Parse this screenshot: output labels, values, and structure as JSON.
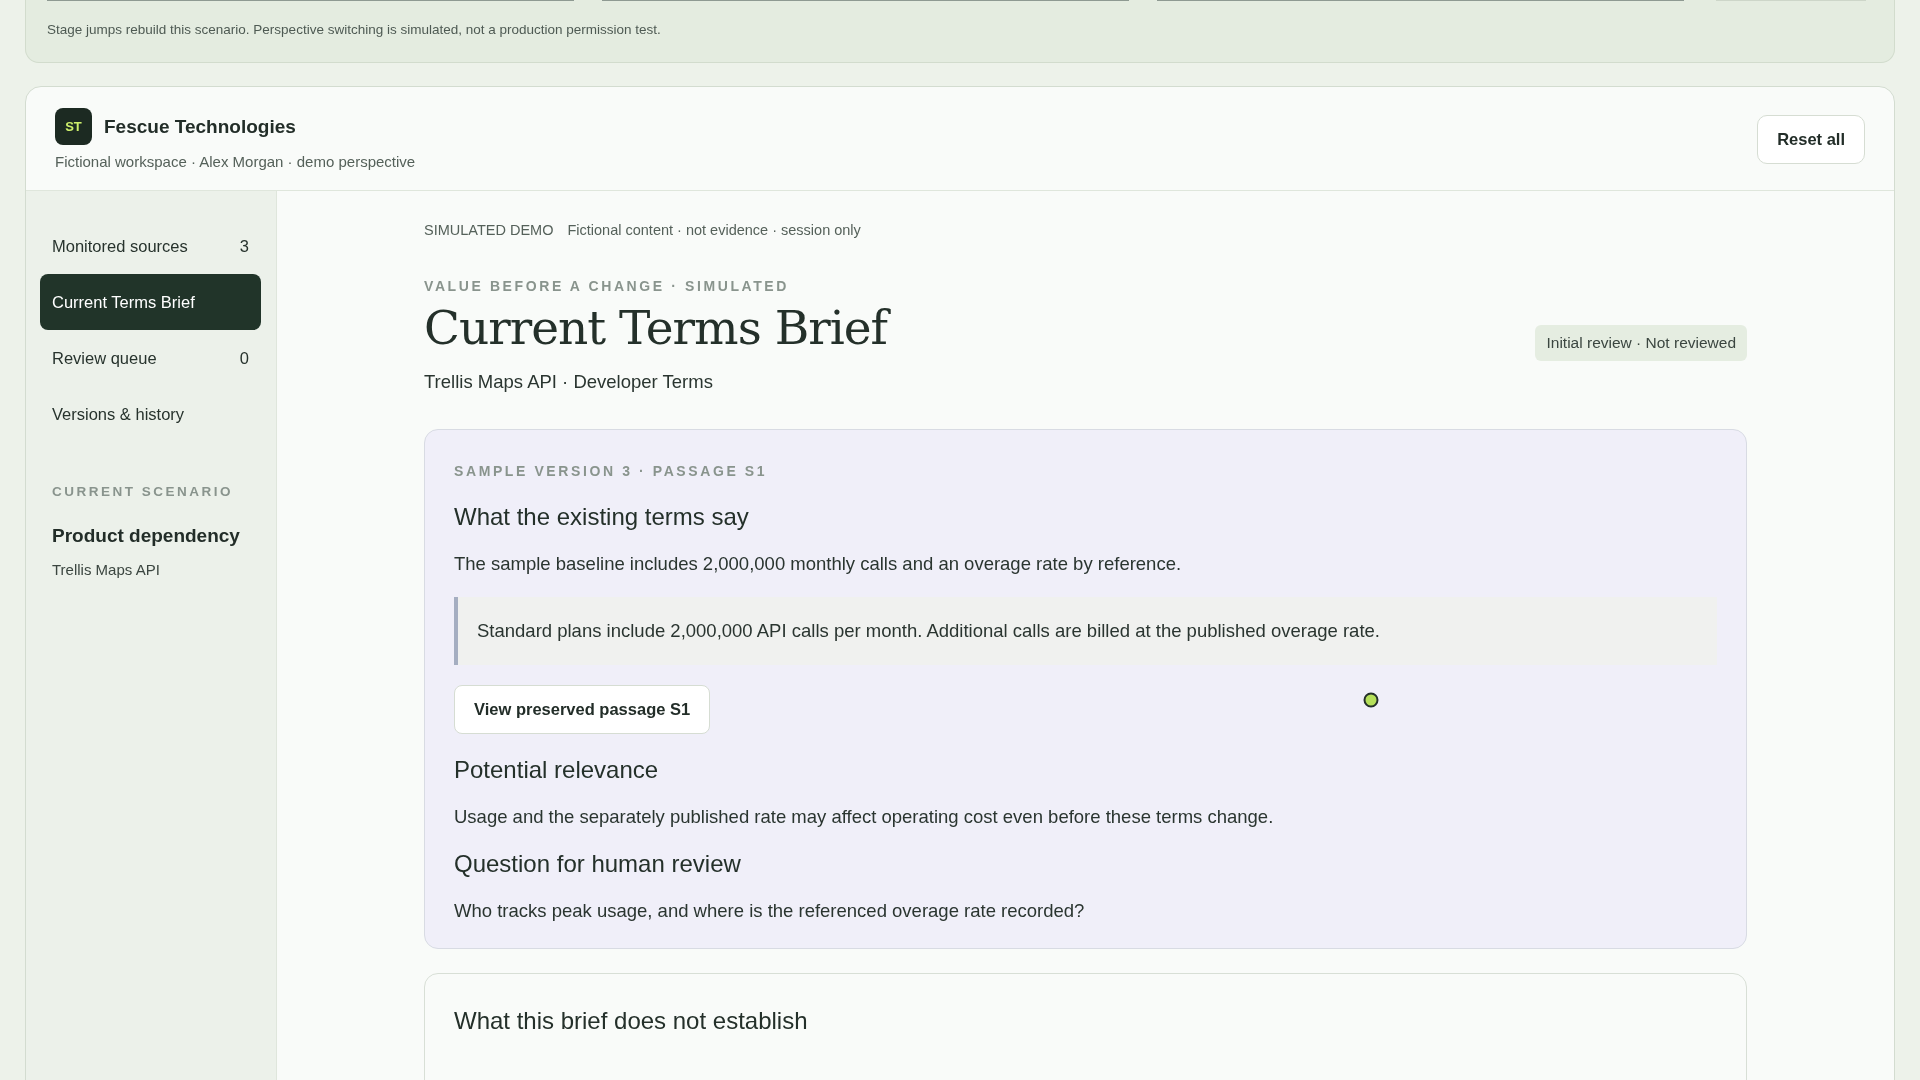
{
  "notice": "Stage jumps rebuild this scenario. Perspective switching is simulated, not a production permission test.",
  "workspace": {
    "initials": "ST",
    "name": "Fescue Technologies",
    "subtitle": "Fictional workspace · Alex Morgan · demo perspective",
    "reset_button": "Reset all"
  },
  "sidebar": {
    "items": [
      {
        "label": "Monitored sources",
        "count": "3",
        "selected": false
      },
      {
        "label": "Current Terms Brief",
        "selected": true
      },
      {
        "label": "Review queue",
        "count": "0",
        "selected": false
      },
      {
        "label": "Versions & history",
        "selected": false
      }
    ],
    "scenario_heading": "CURRENT SCENARIO",
    "scenario_title": "Product dependency",
    "scenario_subject": "Trellis Maps API"
  },
  "main": {
    "demo_tag": "SIMULATED DEMO",
    "demo_note": "Fictional content · not evidence · session only",
    "kicker": "VALUE BEFORE A CHANGE · SIMULATED",
    "title": "Current Terms Brief",
    "subtitle": "Trellis Maps API · Developer Terms",
    "status_badge": "Initial review · Not reviewed",
    "passage_card": {
      "kicker": "SAMPLE VERSION 3 · PASSAGE S1",
      "sections": [
        {
          "kind": "quote",
          "heading": "What the existing terms say",
          "text": "The sample baseline includes 2,000,000 monthly calls and an overage rate by reference.",
          "quote": "Standard plans include 2,000,000 API calls per month. Additional calls are billed at the published overage rate.",
          "button": "View preserved passage S1"
        },
        {
          "kind": "text",
          "heading": "Potential relevance",
          "text": "Usage and the separately published rate may affect operating cost even before these terms change."
        },
        {
          "kind": "text",
          "heading": "Question for human review",
          "text": "Who tracks peak usage, and where is the referenced overage rate recorded?"
        }
      ]
    },
    "next_card": {
      "heading": "What this brief does not establish"
    }
  }
}
